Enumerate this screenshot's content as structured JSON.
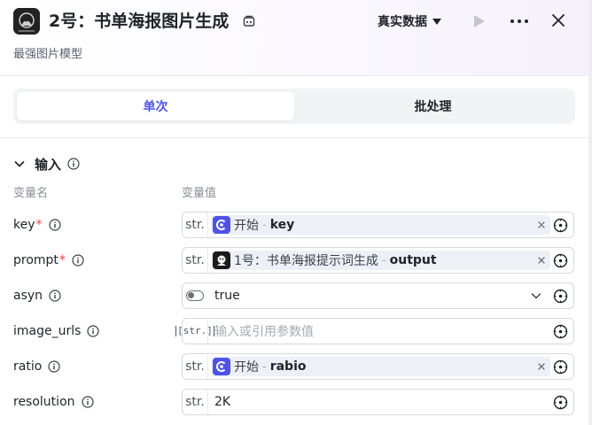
{
  "header": {
    "title": "2号：书单海报图片生成",
    "subtitle": "最强图片模型",
    "data_source": "真实数据"
  },
  "tabs": [
    {
      "label": "单次",
      "active": true
    },
    {
      "label": "批处理",
      "active": false
    }
  ],
  "section": {
    "label": "输入"
  },
  "columns": {
    "name": "变量名",
    "value": "变量值"
  },
  "params": [
    {
      "name": "key",
      "required": true,
      "type": "str.",
      "kind": "ref",
      "ref_node": "开始",
      "ref_var": "key",
      "ref_icon": "start-node-icon"
    },
    {
      "name": "prompt",
      "required": true,
      "type": "str.",
      "kind": "ref",
      "ref_node": "1号：书单海报提示词生成",
      "ref_var": "output",
      "ref_icon": "llm-node-icon"
    },
    {
      "name": "asyn",
      "required": false,
      "type": "toggle",
      "kind": "select",
      "value": "true"
    },
    {
      "name": "image_urls",
      "required": false,
      "type": "[str.]",
      "kind": "empty",
      "placeholder": "输入或引用参数值"
    },
    {
      "name": "ratio",
      "required": false,
      "type": "str.",
      "kind": "ref",
      "ref_node": "开始",
      "ref_var": "rabio",
      "ref_icon": "start-node-icon"
    },
    {
      "name": "resolution",
      "required": false,
      "type": "str.",
      "kind": "text",
      "value": "2K"
    }
  ],
  "colors": {
    "accent": "#4d53e8",
    "required": "#e0454e",
    "start_icon_bg": "#4d53e8",
    "chip_bg": "#eef0f8"
  },
  "ref_separator": "-"
}
